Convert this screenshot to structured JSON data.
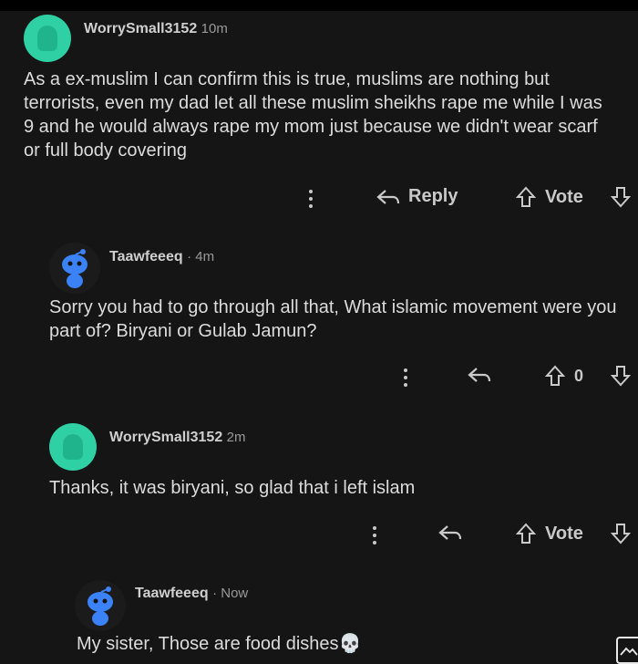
{
  "comments": [
    {
      "username": "WorrySmall3152",
      "time": "10m",
      "text": "As a ex-muslim I can confirm this is true, muslims are nothing but terrorists, even my dad let all these muslim sheikhs rape me while I was 9 and he would always rape my mom just because we didn't wear scarf or full body covering",
      "reply_label": "Reply",
      "vote_label": "Vote",
      "avatar": "green-avatar"
    },
    {
      "username": "Taawfeeeq",
      "time": "· 4m",
      "text": "Sorry you had to go through all that, What islamic movement were you part of? Biryani or Gulab Jamun?",
      "vote_label": "0",
      "avatar": "snoo-avatar"
    },
    {
      "username": "WorrySmall3152",
      "time": "2m",
      "text": "Thanks, it was biryani, so glad that i left islam",
      "vote_label": "Vote",
      "avatar": "green-avatar"
    },
    {
      "username": "Taawfeeeq",
      "time": "· Now",
      "text": "My sister, Those are food dishes",
      "emoji": "💀",
      "avatar": "snoo-avatar"
    }
  ],
  "colors": {
    "background": "#151515",
    "text": "#dcdcdc",
    "avatar_green": "#2fd0a4",
    "snoo_blue": "#3b82f6"
  }
}
